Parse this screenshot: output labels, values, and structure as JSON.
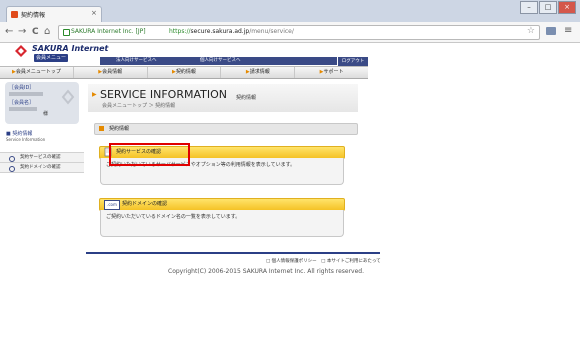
{
  "browser": {
    "tab_title": "契約情報",
    "tab_close": "×",
    "win": {
      "minimize": "–",
      "maximize": "□",
      "close": "×"
    },
    "nav": {
      "back": "←",
      "forward": "→",
      "reload": "C",
      "home": "⌂"
    },
    "ev_badge": "SAKURA Internet Inc. [JP]",
    "url_scheme": "https://",
    "url_host": "secure.sakura.ad.jp",
    "url_path": "/menu/service/",
    "star": "☆",
    "menu": "≡"
  },
  "header": {
    "logo_text": "SAKURA Internet",
    "logo_sub": "会員メニュー",
    "links": [
      "法人向けサービスへ",
      "個人向けサービスへ"
    ],
    "logout": "ログアウト"
  },
  "gnav": [
    "会員メニュートップ",
    "会員情報",
    "契約情報",
    "請求情報",
    "サポート"
  ],
  "sidebar": {
    "member_id_label": "［会員ID］",
    "member_name_label": "［会員名］",
    "honorific": "様",
    "section_title": "契約情報",
    "section_title_en": "Service Information",
    "items": [
      "契約サービスの確認",
      "契約ドメインの確認"
    ]
  },
  "main": {
    "page_title": "SERVICE INFORMATION",
    "page_title_sub": "契約情報",
    "breadcrumb": "会員メニュートップ ＞ 契約情報",
    "section_title": "契約情報",
    "cards": [
      {
        "label": "契約サービスの確認",
        "description": "ご契約いただいているサーバサービスやオプション等の利用情報を表示しています。"
      },
      {
        "label": "契約ドメインの確認",
        "icon_text": ".com",
        "description": "ご契約いただいているドメイン名の一覧を表示しています。"
      }
    ]
  },
  "footer": {
    "links": "□ 個人情報保護ポリシー　□ 本サイトご利用にあたって",
    "copyright": "Copyright(C) 2006-2015 SAKURA Internet Inc. All rights reserved."
  },
  "colors": {
    "brand_navy": "#2b3f86",
    "accent_orange": "#e58a00",
    "card_yellow": "#f5c226",
    "highlight_red": "#e00000"
  }
}
